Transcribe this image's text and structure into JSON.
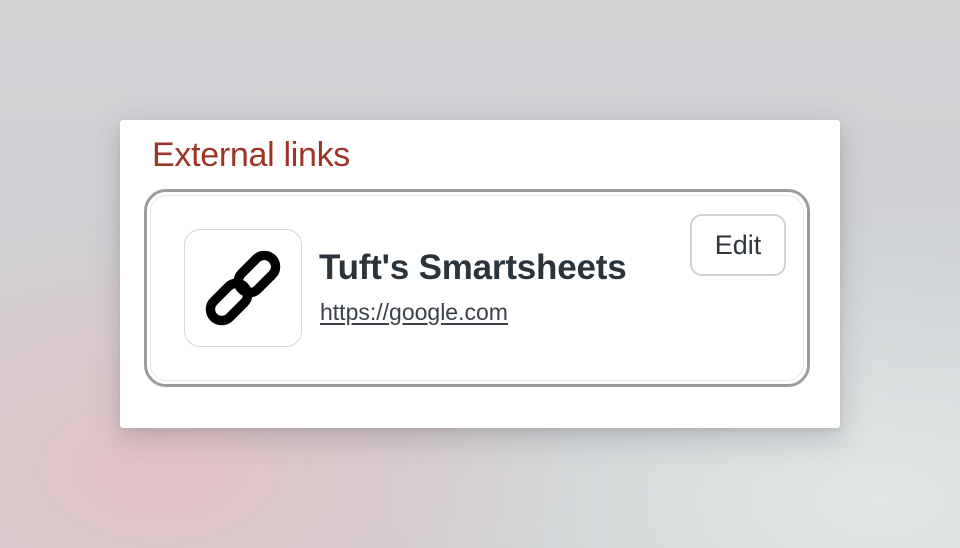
{
  "section": {
    "title": "External links"
  },
  "links": [
    {
      "name": "Tuft's Smartsheets",
      "url": "https://google.com",
      "icon": "link-icon",
      "edit_label": "Edit"
    }
  ],
  "colors": {
    "title": "#9c3427",
    "card_border": "#9a9c9e",
    "text": "#2b333b"
  }
}
